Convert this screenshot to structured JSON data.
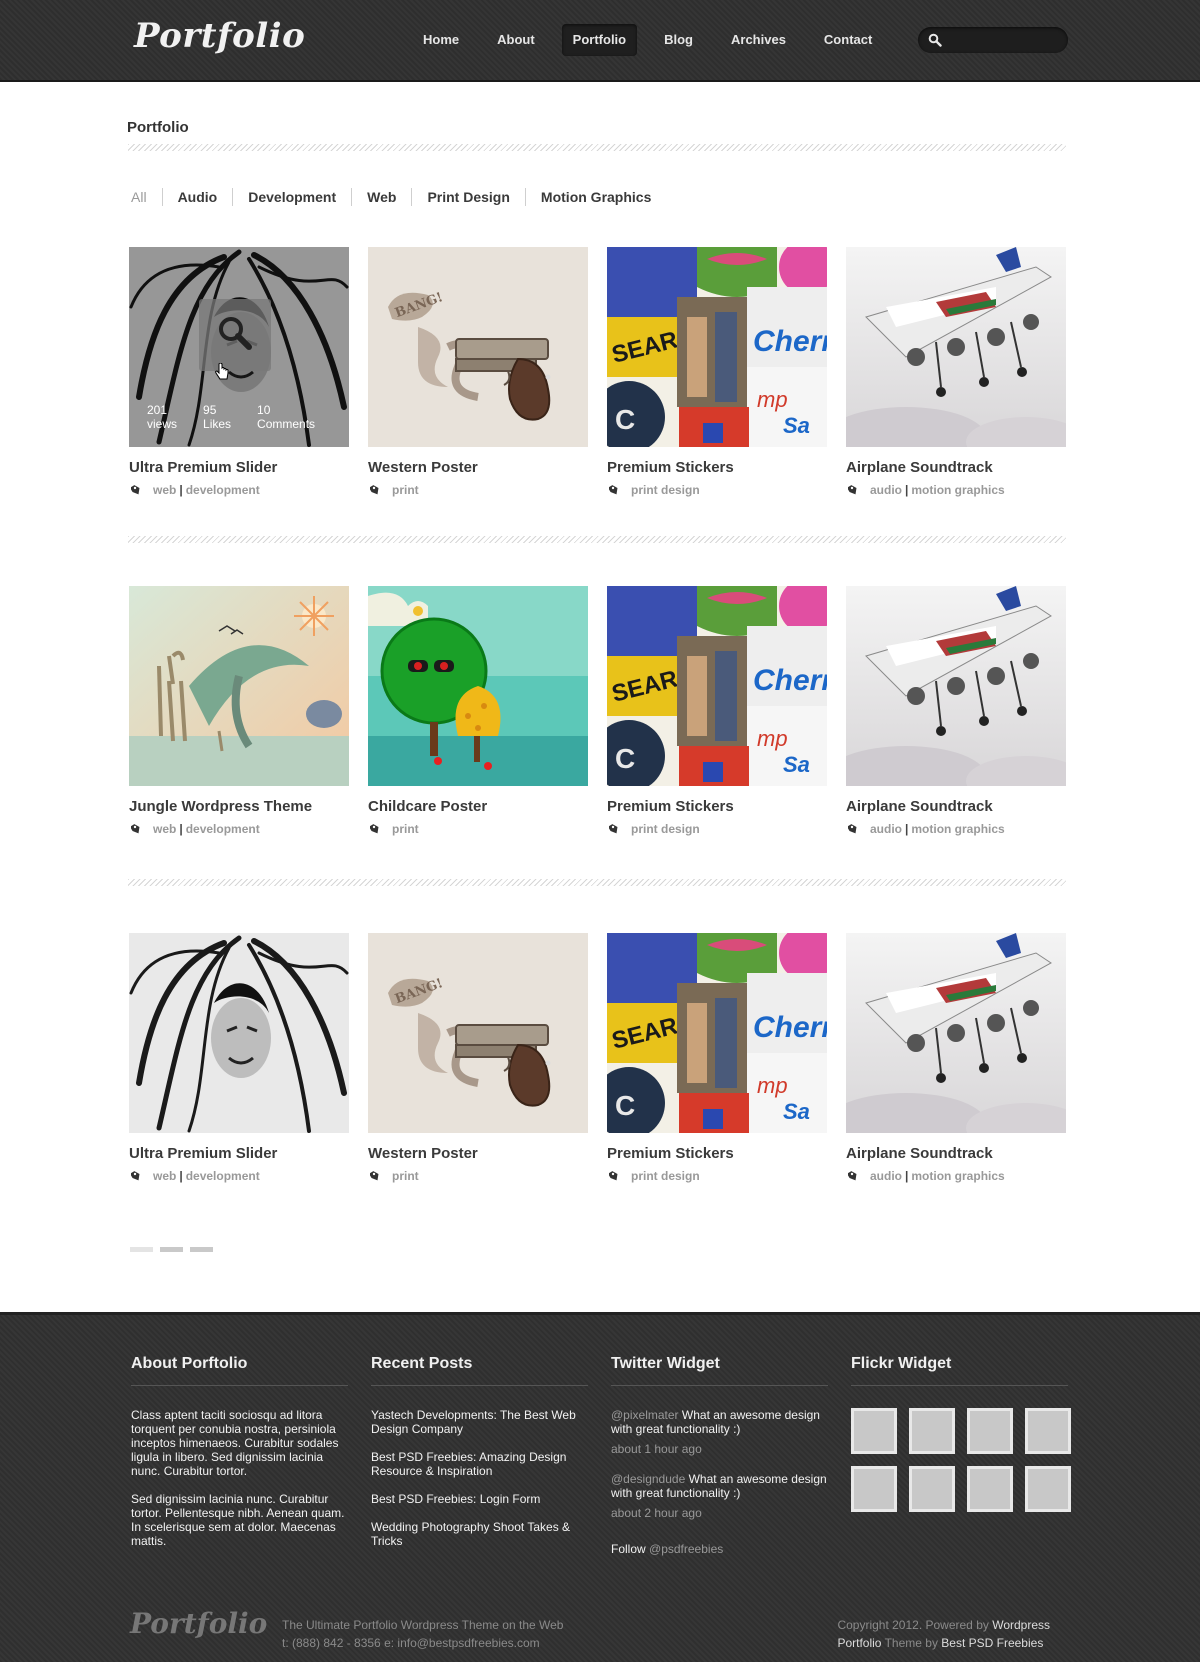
{
  "header": {
    "logo": "Portfolio",
    "nav": [
      "Home",
      "About",
      "Portfolio",
      "Blog",
      "Archives",
      "Contact"
    ],
    "active_nav": "Portfolio",
    "search_placeholder": ""
  },
  "page": {
    "title": "Portfolio",
    "filters": [
      "All",
      "Audio",
      "Development",
      "Web",
      "Print Design",
      "Motion Graphics"
    ]
  },
  "hover_stats": [
    {
      "value": "201",
      "label": "views"
    },
    {
      "value": "95",
      "label": "Likes"
    },
    {
      "value": "10",
      "label": "Comments"
    }
  ],
  "rows": [
    [
      {
        "title": "Ultra Premium Slider",
        "tags": [
          "web",
          "development"
        ],
        "art": "portrait"
      },
      {
        "title": "Western Poster",
        "tags": [
          "print"
        ],
        "art": "gun"
      },
      {
        "title": "Premium Stickers",
        "tags": [
          "print design"
        ],
        "art": "stickers"
      },
      {
        "title": "Airplane Soundtrack",
        "tags": [
          "audio",
          "motion graphics"
        ],
        "art": "airplane"
      }
    ],
    [
      {
        "title": "Jungle Wordpress Theme",
        "tags": [
          "web",
          "development"
        ],
        "art": "jungle"
      },
      {
        "title": "Childcare Poster",
        "tags": [
          "print"
        ],
        "art": "tree"
      },
      {
        "title": "Premium Stickers",
        "tags": [
          "print design"
        ],
        "art": "stickers"
      },
      {
        "title": "Airplane Soundtrack",
        "tags": [
          "audio",
          "motion graphics"
        ],
        "art": "airplane"
      }
    ],
    [
      {
        "title": "Ultra Premium Slider",
        "tags": [
          "web",
          "development"
        ],
        "art": "portrait"
      },
      {
        "title": "Western Poster",
        "tags": [
          "print"
        ],
        "art": "gun"
      },
      {
        "title": "Premium Stickers",
        "tags": [
          "print design"
        ],
        "art": "stickers"
      },
      {
        "title": "Airplane Soundtrack",
        "tags": [
          "audio",
          "motion graphics"
        ],
        "art": "airplane"
      }
    ]
  ],
  "pagination": {
    "pages": 3,
    "current": 1
  },
  "footer": {
    "about": {
      "heading": "About Porftolio",
      "paragraphs": [
        "Class aptent taciti sociosqu ad litora torquent per conubia nostra, persiniola inceptos himenaeos. Curabitur sodales ligula in libero. Sed dignissim lacinia nunc. Curabitur tortor.",
        "Sed dignissim lacinia nunc. Curabitur tortor. Pellentesque nibh. Aenean quam. In scelerisque sem at dolor. Maecenas mattis."
      ]
    },
    "recent": {
      "heading": "Recent Posts",
      "posts": [
        "Yastech Developments: The Best Web Design Company",
        "Best PSD Freebies: Amazing Design Resource & Inspiration",
        "Best PSD Freebies: Login Form",
        "Wedding Photography Shoot Takes & Tricks"
      ]
    },
    "twitter": {
      "heading": "Twitter Widget",
      "tweets": [
        {
          "handle": "@pixelmater",
          "text": "What an awesome design with great functionality :)",
          "ago": "about 1 hour ago"
        },
        {
          "handle": "@designdude",
          "text": "What an awesome design with great functionality :)",
          "ago": "about 2 hour ago"
        }
      ],
      "follow_prefix": "Follow ",
      "follow_handle": "@psdfreebies"
    },
    "flickr": {
      "heading": "Flickr Widget",
      "count": 8
    },
    "logo": "Portfolio",
    "tagline": "The Ultimate Portfolio  Wordpress Theme on the Web",
    "contact": "t: (888) 842 - 8356  e: info@bestpsdfreebies.com",
    "copy1_pre": "Copyright 2012. Powered by ",
    "copy1_hl": "Wordpress",
    "copy2_hl1": "Portfolio",
    "copy2_mid": " Theme by ",
    "copy2_hl2": "Best PSD Freebies"
  },
  "colors": {
    "header_bg": "#333333",
    "footer_bg": "#333333",
    "text": "#3a3a3a",
    "muted": "#999999"
  }
}
